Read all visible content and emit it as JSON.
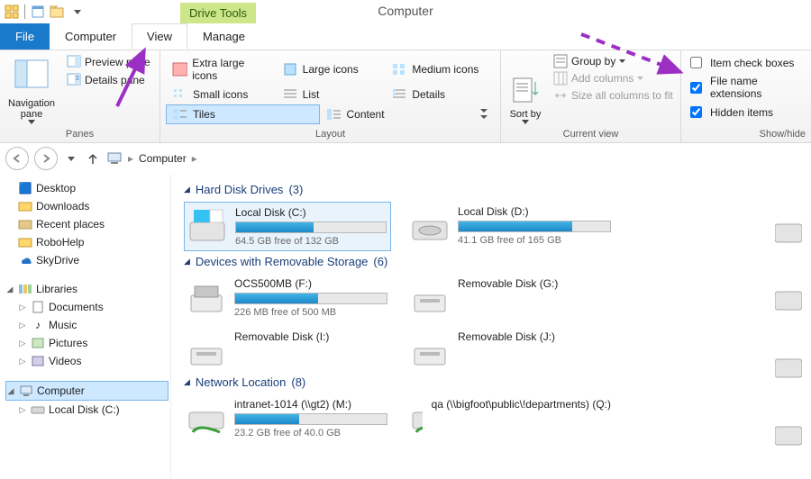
{
  "window": {
    "title": "Computer",
    "context_tab": "Drive Tools"
  },
  "tabs": {
    "file": "File",
    "computer": "Computer",
    "view": "View",
    "manage": "Manage"
  },
  "ribbon": {
    "panes": {
      "nav_label": "Navigation pane",
      "preview": "Preview pane",
      "details": "Details pane",
      "group": "Panes"
    },
    "layout": {
      "items": {
        "xl": "Extra large icons",
        "lg": "Large icons",
        "md": "Medium icons",
        "sm": "Small icons",
        "list": "List",
        "det": "Details",
        "tiles": "Tiles",
        "content": "Content"
      },
      "group": "Layout"
    },
    "current_view": {
      "sort": "Sort by",
      "group_by": "Group by",
      "add_cols": "Add columns",
      "size_cols": "Size all columns to fit",
      "group": "Current view"
    },
    "showhide": {
      "item_check": "Item check boxes",
      "ext": "File name extensions",
      "hidden": "Hidden items",
      "group": "Show/hide"
    }
  },
  "breadcrumb": {
    "root": "Computer"
  },
  "tree": {
    "fav": [
      "Desktop",
      "Downloads",
      "Recent places",
      "RoboHelp",
      "SkyDrive"
    ],
    "libs_label": "Libraries",
    "libs": [
      "Documents",
      "Music",
      "Pictures",
      "Videos"
    ],
    "computer": "Computer",
    "comp_children": [
      "Local Disk (C:)"
    ]
  },
  "sections": {
    "hdd": {
      "title": "Hard Disk Drives",
      "count": "(3)"
    },
    "removable": {
      "title": "Devices with Removable Storage",
      "count": "(6)"
    },
    "network": {
      "title": "Network Location",
      "count": "(8)"
    }
  },
  "drives": {
    "c": {
      "name": "Local Disk (C:)",
      "free": "64.5 GB free of 132 GB",
      "pct": 52
    },
    "d": {
      "name": "Local Disk (D:)",
      "free": "41.1 GB free of 165 GB",
      "pct": 75
    },
    "f": {
      "name": "OCS500MB (F:)",
      "free": "226 MB free of 500 MB",
      "pct": 55
    },
    "g": {
      "name": "Removable Disk (G:)"
    },
    "i": {
      "name": "Removable Disk (I:)"
    },
    "j": {
      "name": "Removable Disk (J:)"
    },
    "m": {
      "name": "intranet-1014 (\\\\gt2) (M:)",
      "free": "23.2 GB free of 40.0 GB",
      "pct": 42
    },
    "q": {
      "name": "qa (\\\\bigfoot\\public\\!departments) (Q:)"
    }
  }
}
